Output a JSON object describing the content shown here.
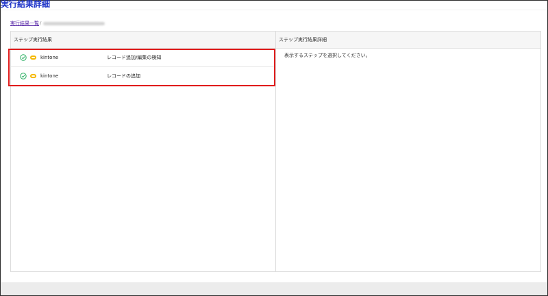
{
  "page": {
    "title": "実行結果詳細"
  },
  "breadcrumb": {
    "link_label": "実行結果一覧",
    "separator": "/"
  },
  "left_panel": {
    "header": "ステップ実行結果",
    "steps": [
      {
        "status_icon": "check-circle-icon",
        "app_icon": "kintone-icon",
        "service": "kintone",
        "action": "レコード追加/編集の検知"
      },
      {
        "status_icon": "check-circle-icon",
        "app_icon": "kintone-icon",
        "service": "kintone",
        "action": "レコードの追加"
      }
    ]
  },
  "right_panel": {
    "header": "ステップ実行結果詳細",
    "placeholder": "表示するステップを選択してください。"
  },
  "colors": {
    "title": "#1d33c8",
    "highlight": "#e01b1b",
    "success": "#27ae60",
    "kintone": "#f5b800"
  }
}
